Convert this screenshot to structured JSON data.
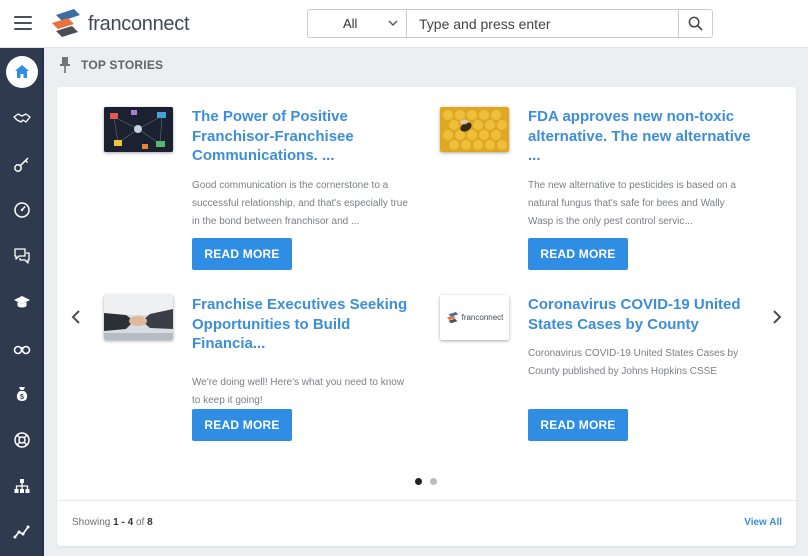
{
  "header": {
    "logo_text": "franconnect",
    "search": {
      "scope": "All",
      "placeholder": "Type and press enter"
    }
  },
  "sidebar": {
    "items": [
      {
        "icon": "home-icon",
        "active": true
      },
      {
        "icon": "handshake-icon"
      },
      {
        "icon": "key-icon"
      },
      {
        "icon": "gauge-icon"
      },
      {
        "icon": "chat-icon"
      },
      {
        "icon": "graduation-cap-icon"
      },
      {
        "icon": "binoculars-icon"
      },
      {
        "icon": "money-bag-icon"
      },
      {
        "icon": "lifebuoy-icon"
      },
      {
        "icon": "org-chart-icon"
      },
      {
        "icon": "trend-line-icon"
      }
    ]
  },
  "section": {
    "title": "TOP STORIES"
  },
  "stories": [
    {
      "title": "The Power of Positive Franchisor-Franchisee Communications. ...",
      "description": "Good communication is the cornerstone to a successful relationship, and that's especially true in the bond between franchisor and ...",
      "button": "READ MORE"
    },
    {
      "title": "FDA approves new non-toxic alternative. The new alternative ...",
      "description": "The new alternative to pesticides is based on a natural fungus that's safe for bees and Wally Wasp is the only pest control servic...",
      "button": "READ MORE"
    },
    {
      "title": "Franchise Executives Seeking Opportunities to Build Financia...",
      "description": "We're doing well! Here's what you need to know to keep it going!",
      "button": "READ MORE"
    },
    {
      "title": "Coronavirus COVID-19 United States Cases by County",
      "description": "Coronavirus COVID-19 United States Cases by County published by Johns Hopkins CSSE",
      "button": "READ MORE",
      "thumb_logo_text": "franconnect"
    }
  ],
  "pagination": {
    "showing_label": "Showing",
    "range": "1 - 4",
    "of_label": "of",
    "total": "8",
    "view_all": "View All",
    "page_count": 2,
    "current_page": 1
  },
  "colors": {
    "accent": "#2f8de4",
    "link": "#3c8ed9",
    "sidebar": "#2f3a4e"
  }
}
